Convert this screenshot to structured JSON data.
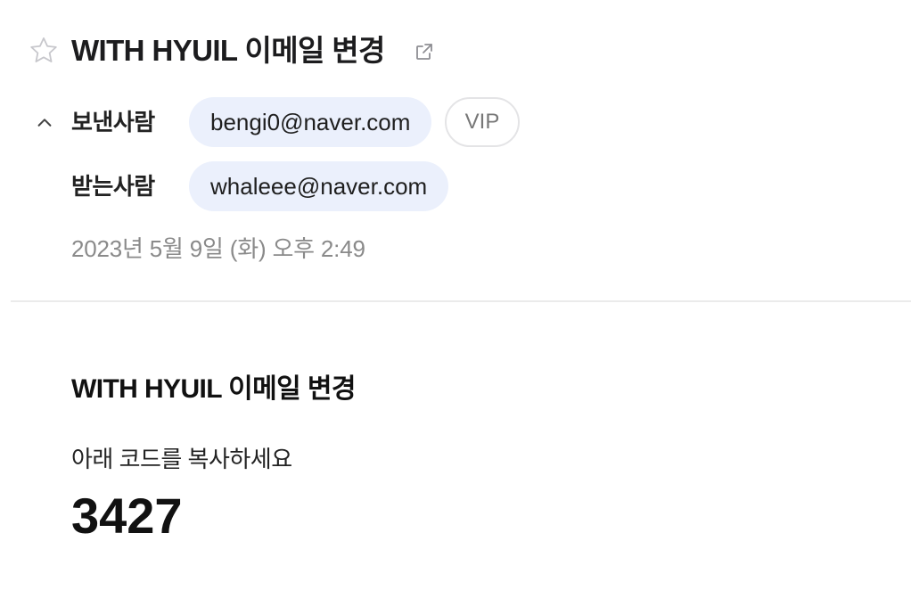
{
  "header": {
    "subject": "WITH HYUIL 이메일 변경",
    "star_icon": "star-outline-icon",
    "popout_icon": "external-link-icon"
  },
  "meta": {
    "collapse_icon": "chevron-up-icon",
    "sender_label": "보낸사람",
    "sender_email": "bengi0@naver.com",
    "vip_label": "VIP",
    "recipient_label": "받는사람",
    "recipient_email": "whaleee@naver.com",
    "date": "2023년 5월 9일 (화) 오후 2:49"
  },
  "body": {
    "title": "WITH HYUIL 이메일 변경",
    "instruction": "아래 코드를 복사하세요",
    "code": "3427"
  },
  "colors": {
    "chip_background": "#ebf0fc",
    "date_text": "#8a8a8a",
    "divider": "#ebebeb"
  }
}
